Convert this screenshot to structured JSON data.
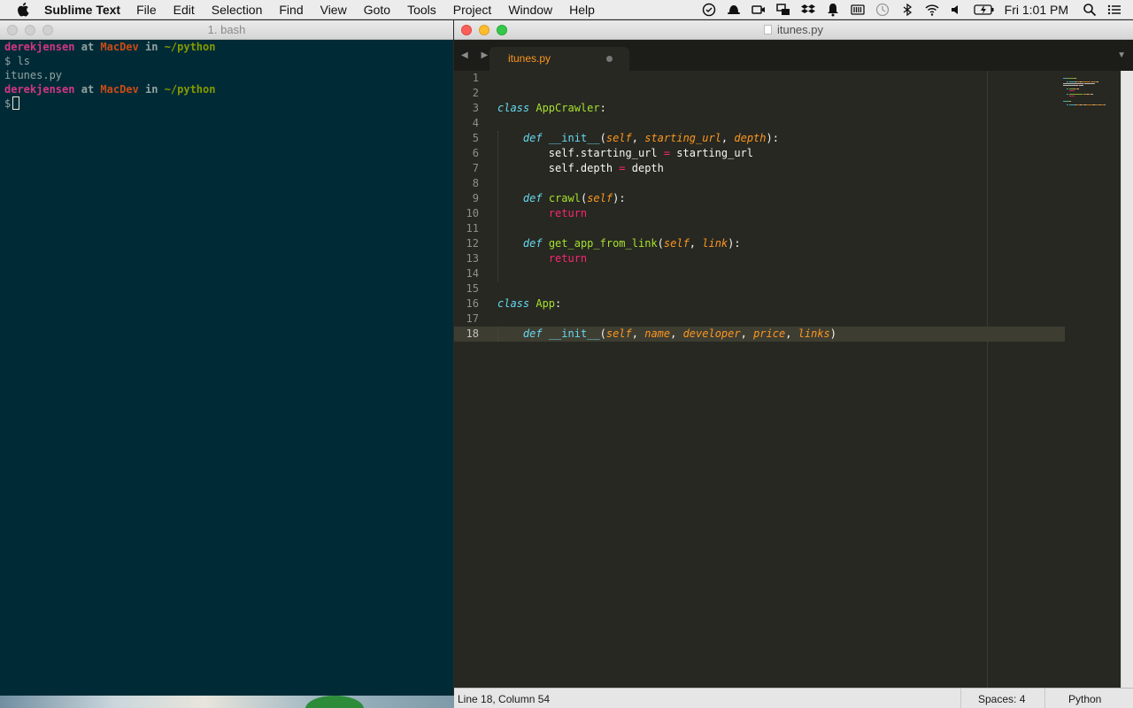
{
  "menubar": {
    "app_name": "Sublime Text",
    "menus": [
      "File",
      "Edit",
      "Selection",
      "Find",
      "View",
      "Goto",
      "Tools",
      "Project",
      "Window",
      "Help"
    ],
    "clock": "Fri 1:01 PM",
    "status_icons": [
      "checklist-icon",
      "hat-icon",
      "video-icon",
      "screens-icon",
      "dropbox-icon",
      "bell-icon",
      "battery-meter-icon",
      "time-machine-icon",
      "bluetooth-icon",
      "wifi-icon",
      "volume-icon",
      "battery-icon",
      "spotlight-icon",
      "notification-center-icon"
    ]
  },
  "terminal": {
    "title": "1. bash",
    "prompt": {
      "user": "derekjensen",
      "at": "at",
      "host": "MacDev",
      "in": "in",
      "path": "~/python",
      "symbol": "$"
    },
    "command": "ls",
    "output": "itunes.py",
    "colors": {
      "user": "#d33682",
      "host": "#cb4b16",
      "path": "#859900",
      "background": "#002b36"
    }
  },
  "editor": {
    "window_title": "itunes.py",
    "tab_label": "itunes.py",
    "tab_dirty": true,
    "lines": [
      {
        "n": "1",
        "tokens": []
      },
      {
        "n": "2",
        "tokens": []
      },
      {
        "n": "3",
        "tokens": [
          {
            "c": "k-kw",
            "t": "class"
          },
          {
            "c": "k-txt",
            "t": " "
          },
          {
            "c": "k-cls",
            "t": "AppCrawler"
          },
          {
            "c": "k-txt",
            "t": ":"
          }
        ]
      },
      {
        "n": "4",
        "tokens": []
      },
      {
        "n": "5",
        "tokens": [
          {
            "c": "k-txt",
            "t": "    "
          },
          {
            "c": "k-kw",
            "t": "def"
          },
          {
            "c": "k-txt",
            "t": " "
          },
          {
            "c": "k-init",
            "t": "__init__"
          },
          {
            "c": "k-txt",
            "t": "("
          },
          {
            "c": "k-par",
            "t": "self"
          },
          {
            "c": "k-txt",
            "t": ", "
          },
          {
            "c": "k-par",
            "t": "starting_url"
          },
          {
            "c": "k-txt",
            "t": ", "
          },
          {
            "c": "k-par",
            "t": "depth"
          },
          {
            "c": "k-txt",
            "t": "):"
          }
        ]
      },
      {
        "n": "6",
        "tokens": [
          {
            "c": "k-txt",
            "t": "        self.starting_url "
          },
          {
            "c": "k-op",
            "t": "="
          },
          {
            "c": "k-txt",
            "t": " starting_url"
          }
        ]
      },
      {
        "n": "7",
        "tokens": [
          {
            "c": "k-txt",
            "t": "        self.depth "
          },
          {
            "c": "k-op",
            "t": "="
          },
          {
            "c": "k-txt",
            "t": " depth"
          }
        ]
      },
      {
        "n": "8",
        "tokens": []
      },
      {
        "n": "9",
        "tokens": [
          {
            "c": "k-txt",
            "t": "    "
          },
          {
            "c": "k-kw",
            "t": "def"
          },
          {
            "c": "k-txt",
            "t": " "
          },
          {
            "c": "k-fn",
            "t": "crawl"
          },
          {
            "c": "k-txt",
            "t": "("
          },
          {
            "c": "k-par",
            "t": "self"
          },
          {
            "c": "k-txt",
            "t": "):"
          }
        ]
      },
      {
        "n": "10",
        "tokens": [
          {
            "c": "k-txt",
            "t": "        "
          },
          {
            "c": "k-ret",
            "t": "return"
          }
        ]
      },
      {
        "n": "11",
        "tokens": []
      },
      {
        "n": "12",
        "tokens": [
          {
            "c": "k-txt",
            "t": "    "
          },
          {
            "c": "k-kw",
            "t": "def"
          },
          {
            "c": "k-txt",
            "t": " "
          },
          {
            "c": "k-fn",
            "t": "get_app_from_link"
          },
          {
            "c": "k-txt",
            "t": "("
          },
          {
            "c": "k-par",
            "t": "self"
          },
          {
            "c": "k-txt",
            "t": ", "
          },
          {
            "c": "k-par",
            "t": "link"
          },
          {
            "c": "k-txt",
            "t": "):"
          }
        ]
      },
      {
        "n": "13",
        "tokens": [
          {
            "c": "k-txt",
            "t": "        "
          },
          {
            "c": "k-ret",
            "t": "return"
          }
        ]
      },
      {
        "n": "14",
        "tokens": []
      },
      {
        "n": "15",
        "tokens": []
      },
      {
        "n": "16",
        "tokens": [
          {
            "c": "k-kw",
            "t": "class"
          },
          {
            "c": "k-txt",
            "t": " "
          },
          {
            "c": "k-cls",
            "t": "App"
          },
          {
            "c": "k-txt",
            "t": ":"
          }
        ]
      },
      {
        "n": "17",
        "tokens": []
      },
      {
        "n": "18",
        "active": true,
        "tokens": [
          {
            "c": "k-txt",
            "t": "    "
          },
          {
            "c": "k-kw",
            "t": "def"
          },
          {
            "c": "k-txt",
            "t": " "
          },
          {
            "c": "k-init",
            "t": "__init__"
          },
          {
            "c": "k-txt",
            "t": "("
          },
          {
            "c": "k-par",
            "t": "self"
          },
          {
            "c": "k-txt",
            "t": ", "
          },
          {
            "c": "k-par",
            "t": "name"
          },
          {
            "c": "k-txt",
            "t": ", "
          },
          {
            "c": "k-par",
            "t": "developer"
          },
          {
            "c": "k-txt",
            "t": ", "
          },
          {
            "c": "k-par",
            "t": "price"
          },
          {
            "c": "k-txt",
            "t": ", "
          },
          {
            "c": "k-par",
            "t": "links"
          },
          {
            "c": "k-txt",
            "t": ")"
          }
        ]
      }
    ],
    "status": {
      "position": "Line 18, Column 54",
      "spaces": "Spaces: 4",
      "syntax": "Python"
    },
    "theme_colors": {
      "background": "#272822",
      "keyword": "#66d9ef",
      "function": "#a6e22e",
      "parameter": "#fd971f",
      "operator": "#f92672"
    }
  }
}
